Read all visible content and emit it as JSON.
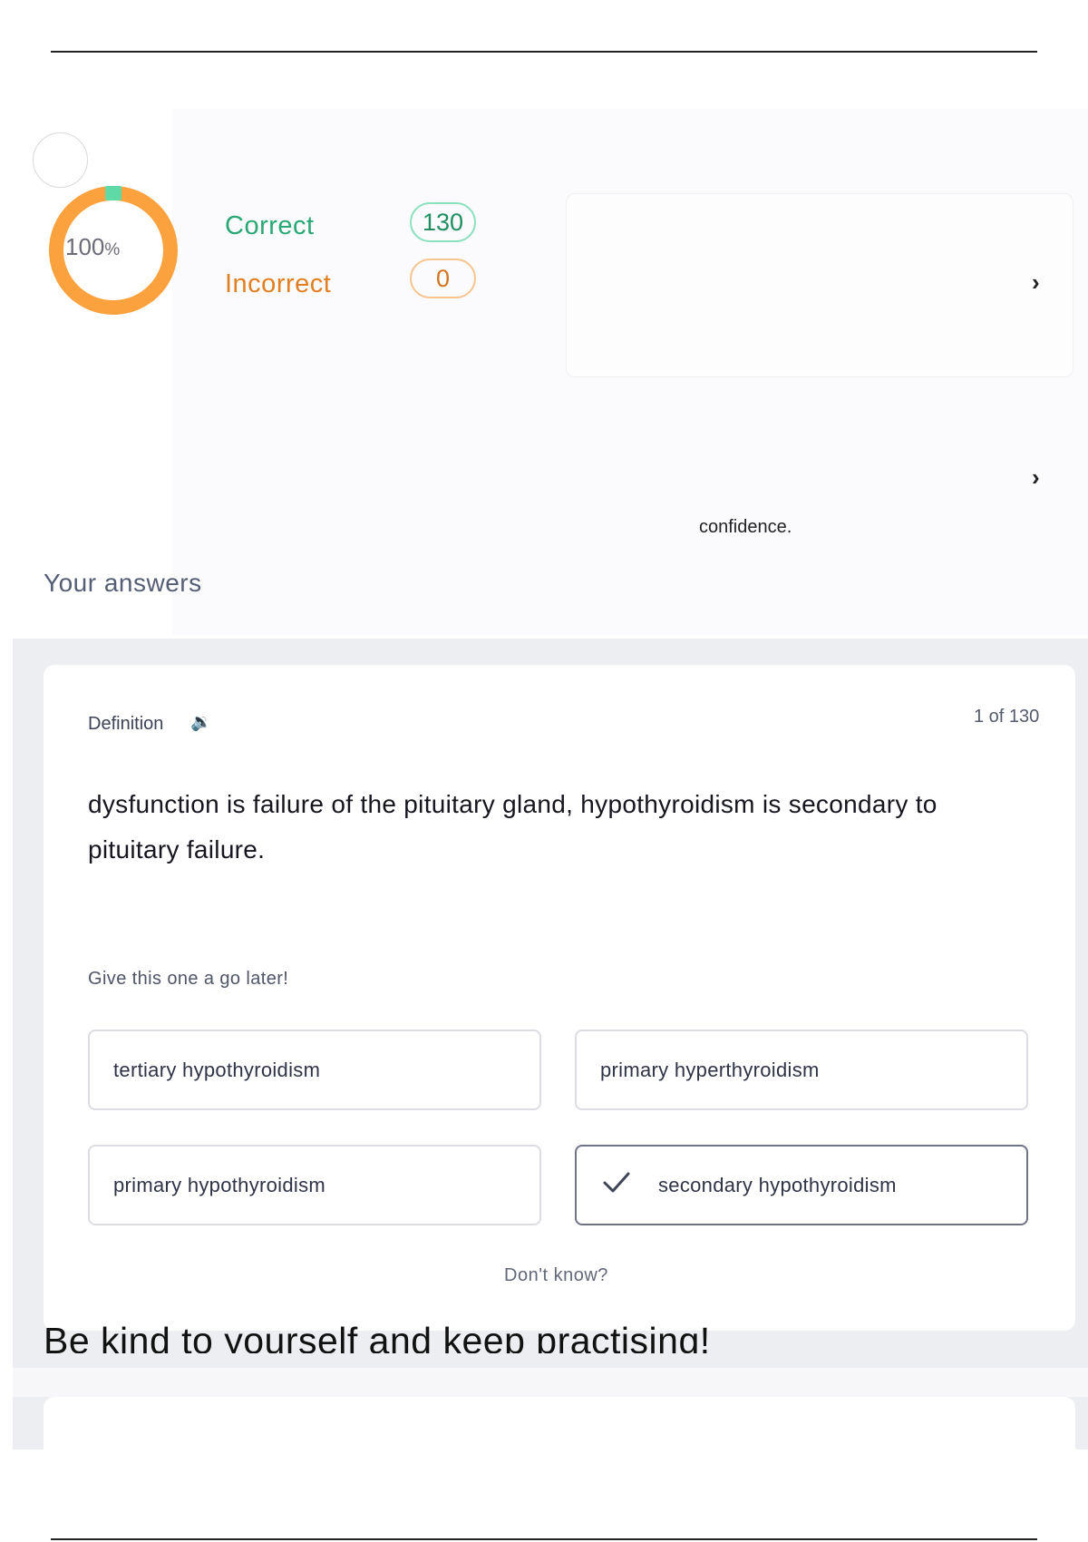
{
  "summary": {
    "percentage": "100",
    "percent_sign": "%",
    "correct_label": "Correct",
    "correct_count": "130",
    "incorrect_label": "Incorrect",
    "incorrect_count": "0"
  },
  "confidence_text": "confidence.",
  "your_answers_title": "Your answers",
  "question_card": {
    "type_label": "Definition",
    "counter": "1 of 130",
    "text": "dysfunction is failure of the pituitary gland, hypothyroidism is secondary to pituitary failure.",
    "later_prompt": "Give this one a go later!",
    "options": [
      {
        "label": "tertiary hypothyroidism",
        "selected": false
      },
      {
        "label": "primary hyperthyroidism",
        "selected": false
      },
      {
        "label": "primary hypothyroidism",
        "selected": false
      },
      {
        "label": "secondary hypothyroidism",
        "selected": true
      }
    ],
    "dont_know": "Don't know?"
  },
  "overlay_message": "Be kind to yourself and keep practising!",
  "colors": {
    "correct": "#28a874",
    "incorrect": "#e27f22",
    "donut_ring": "#fba23e",
    "donut_segment": "#5fd9a6"
  }
}
